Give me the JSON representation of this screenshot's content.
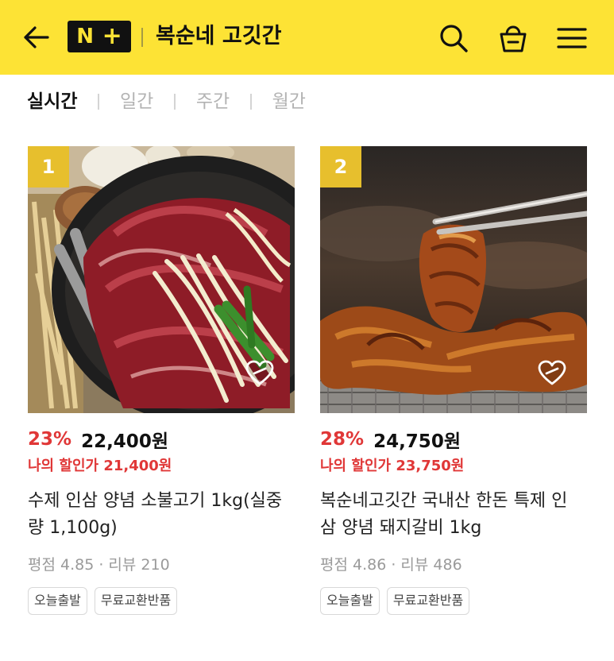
{
  "header": {
    "store_name": "복순네 고깃간",
    "logo_letter": "N",
    "logo_plus": "+",
    "bg_color": "#fde335",
    "icons": [
      "back-arrow-icon",
      "search-icon",
      "shopping-bag-icon",
      "menu-icon"
    ]
  },
  "tabs": [
    {
      "label": "실시간",
      "active": true
    },
    {
      "label": "일간",
      "active": false
    },
    {
      "label": "주간",
      "active": false
    },
    {
      "label": "월간",
      "active": false
    }
  ],
  "products": [
    {
      "rank": "1",
      "discount": "23%",
      "price": "22,400원",
      "my_price": "나의 할인가 21,400원",
      "title": "수제 인삼 양념 소불고기 1kg(실중량 1,100g)",
      "rating": "평점 4.85 · 리뷰 210",
      "badges": [
        "오늘출발",
        "무료교환반품"
      ]
    },
    {
      "rank": "2",
      "discount": "28%",
      "price": "24,750원",
      "my_price": "나의 할인가 23,750원",
      "title": "복순네고깃간 국내산 한돈 특제 인삼 양념 돼지갈비 1kg",
      "rating": "평점 4.86 · 리뷰 486",
      "badges": [
        "오늘출발",
        "무료교환반품"
      ]
    }
  ],
  "colors": {
    "accent_yellow": "#fde335",
    "rank_badge": "#e7bf2d",
    "discount_red": "#e03737"
  }
}
